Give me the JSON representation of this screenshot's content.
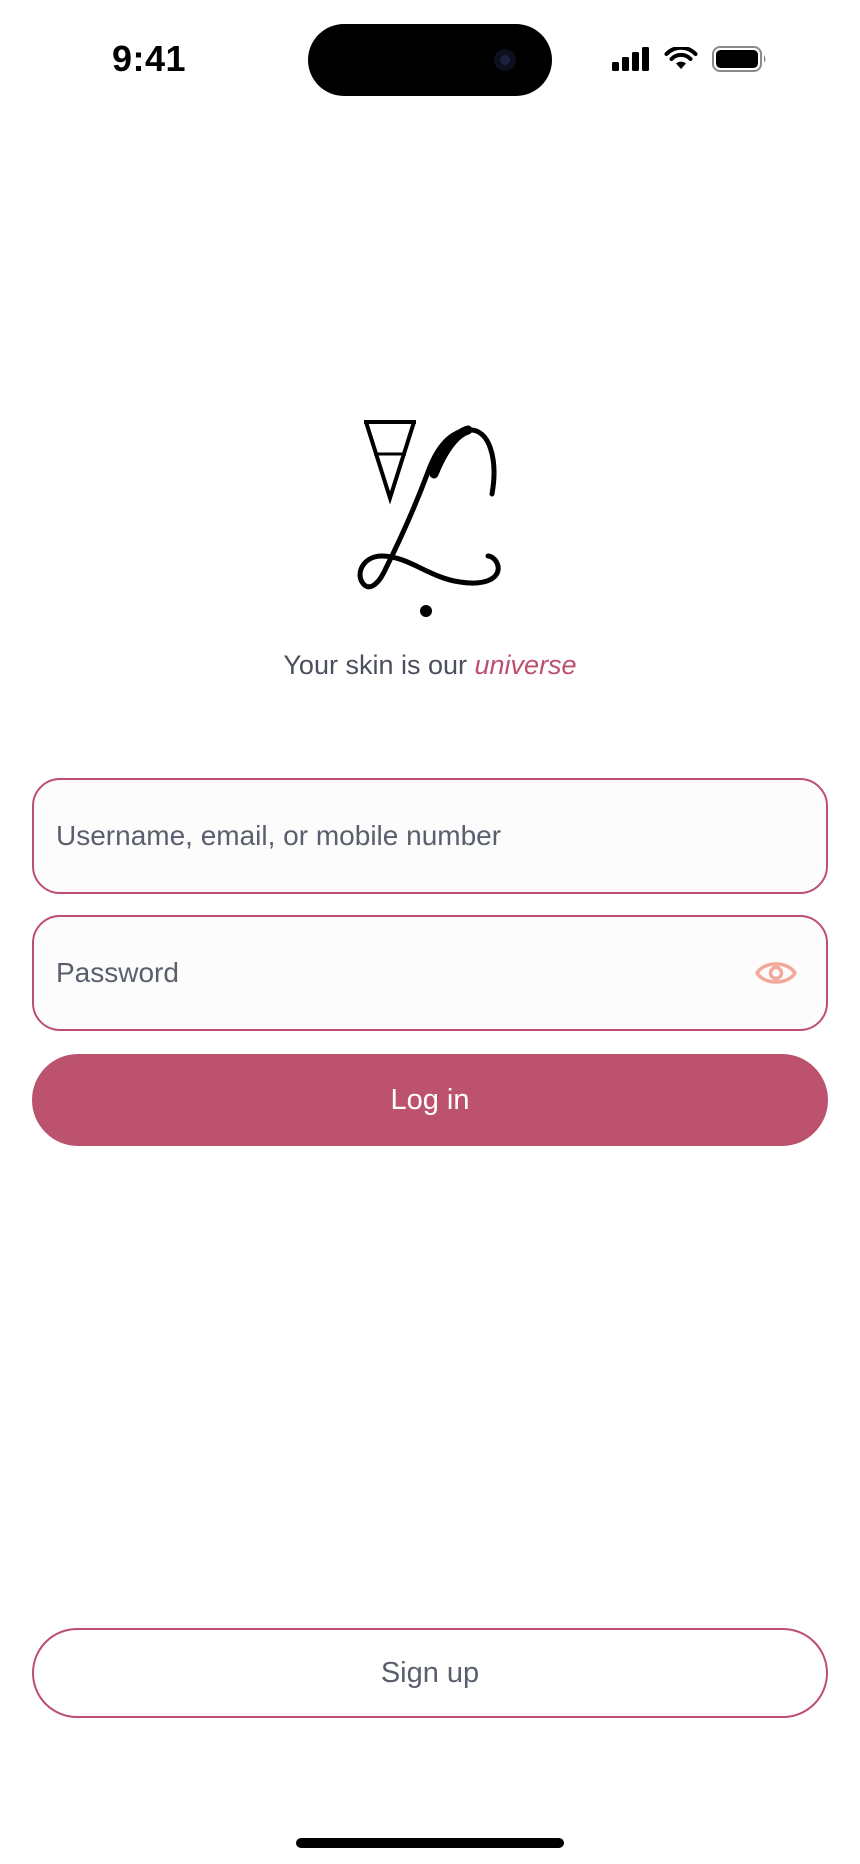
{
  "status_bar": {
    "time": "9:41",
    "icons": [
      "cellular-signal-icon",
      "wifi-icon",
      "battery-icon"
    ]
  },
  "branding": {
    "logo_icon": "brand-monogram-logo",
    "tagline_prefix": "Your skin is our ",
    "tagline_accent": "universe"
  },
  "login_form": {
    "username_placeholder": "Username, email, or mobile number",
    "username_value": "",
    "password_placeholder": "Password",
    "password_value": "",
    "show_password_icon": "eye-icon",
    "login_label": "Log in"
  },
  "footer": {
    "signup_label": "Sign up"
  },
  "colors": {
    "accent": "#bd526e",
    "eye_icon": "#f2a99a",
    "text": "#4b4f5e",
    "background": "#ffffff"
  }
}
